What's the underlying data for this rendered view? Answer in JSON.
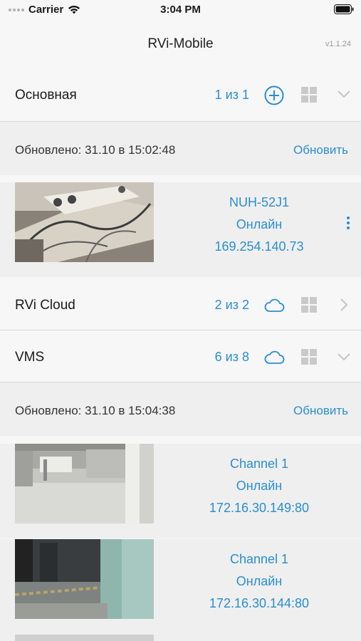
{
  "status_bar": {
    "carrier": "Carrier",
    "time": "3:04 PM"
  },
  "app": {
    "title": "RVi-Mobile",
    "version": "v1.1.24"
  },
  "groups": [
    {
      "name": "Основная",
      "count": "1 из 1",
      "updated": "Обновлено: 31.10 в 15:02:48",
      "refresh_label": "Обновить",
      "cameras": [
        {
          "name": "NUH-52J1",
          "status": "Онлайн",
          "address": "169.254.140.73"
        }
      ]
    },
    {
      "name": "RVi Cloud",
      "count": "2 из 2"
    },
    {
      "name": "VMS",
      "count": "6 из 8",
      "updated": "Обновлено: 31.10 в 15:04:38",
      "refresh_label": "Обновить",
      "cameras": [
        {
          "name": "Channel 1",
          "status": "Онлайн",
          "address": "172.16.30.149:80"
        },
        {
          "name": "Channel 1",
          "status": "Онлайн",
          "address": "172.16.30.144:80"
        }
      ]
    }
  ],
  "colors": {
    "accent": "#2a8ed0",
    "background": "#f7f7f7",
    "panel": "#efefef"
  }
}
